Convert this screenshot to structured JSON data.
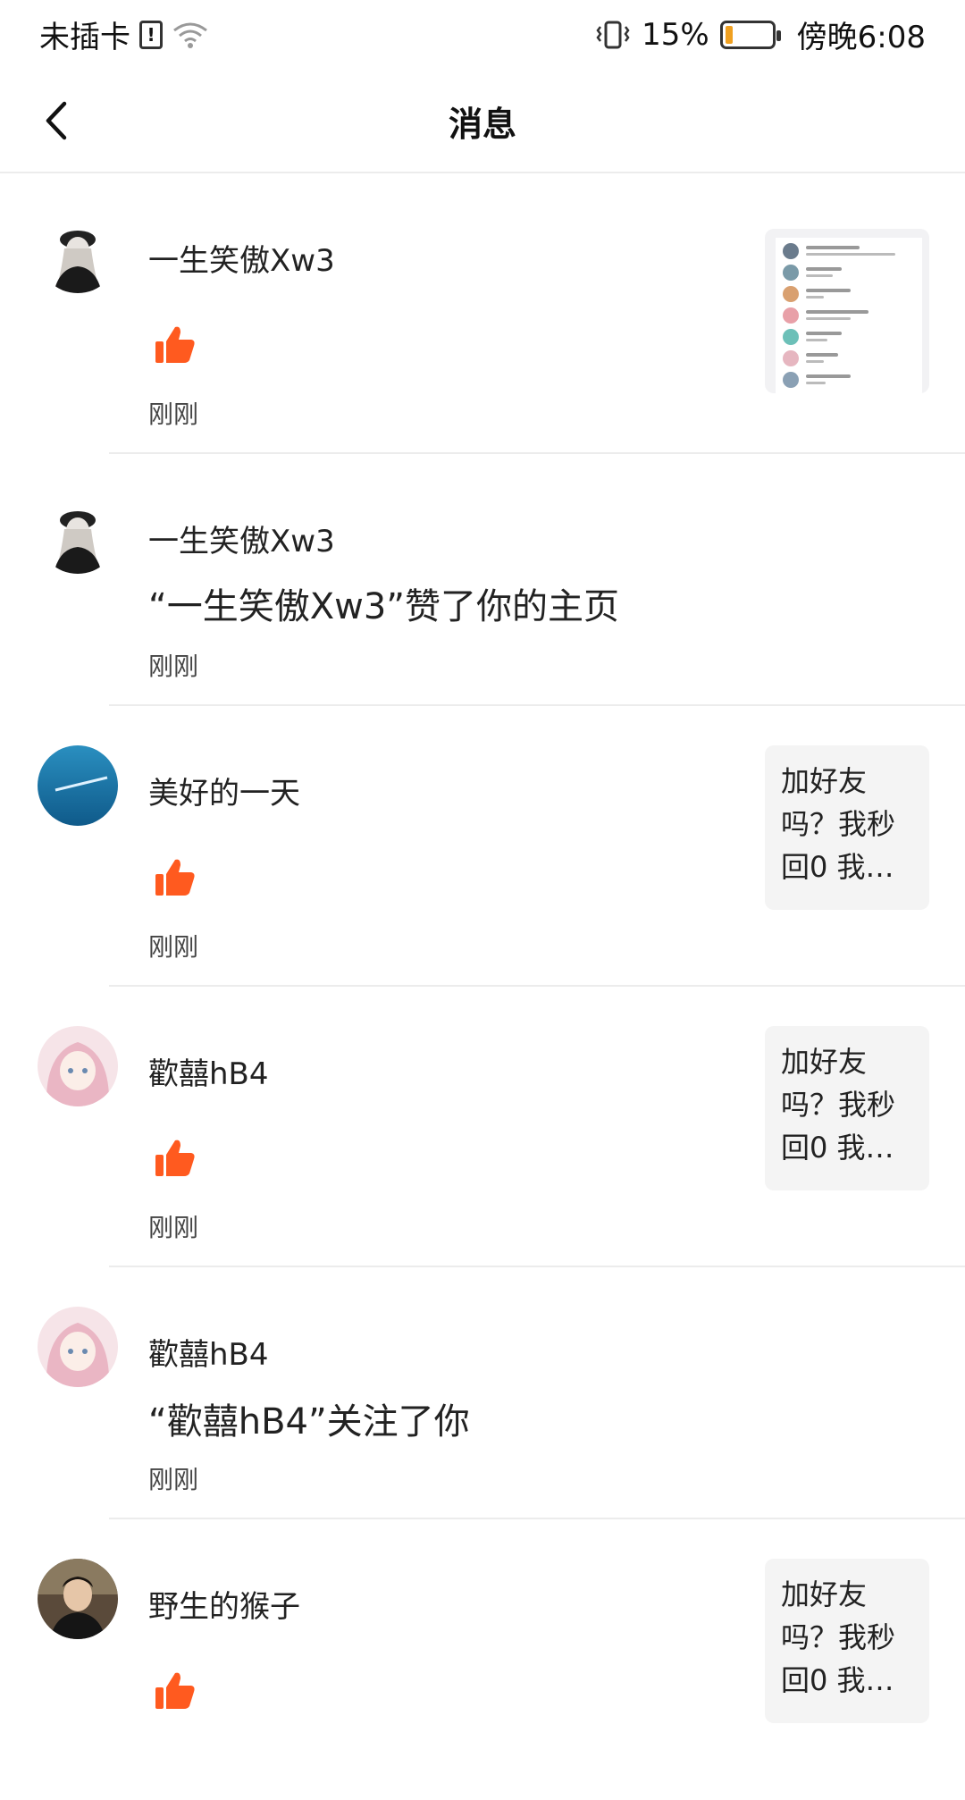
{
  "status_bar": {
    "carrier": "未插卡",
    "sim_icon": "sim-alert-icon",
    "wifi_icon": "wifi-icon",
    "vibrate_icon": "vibrate-icon",
    "battery_percent": "15%",
    "battery_level": 0.15,
    "time": "傍晚6:08"
  },
  "header": {
    "back_icon": "chevron-left-icon",
    "title": "消息"
  },
  "messages": [
    {
      "username": "一生笑傲Xw3",
      "action": "like",
      "text": "",
      "time": "刚刚",
      "preview_type": "screenshot",
      "preview_text": ""
    },
    {
      "username": "一生笑傲Xw3",
      "action": "text",
      "text": "“一生笑傲Xw3”赞了你的主页",
      "time": "刚刚",
      "preview_type": "none",
      "preview_text": ""
    },
    {
      "username": "美好的一天",
      "action": "like",
      "text": "",
      "time": "刚刚",
      "preview_type": "text",
      "preview_text": "加好友吗？我秒回0 我…"
    },
    {
      "username": "歡囍hB4",
      "action": "like",
      "text": "",
      "time": "刚刚",
      "preview_type": "text",
      "preview_text": "加好友吗？我秒回0 我…"
    },
    {
      "username": "歡囍hB4",
      "action": "text",
      "text": "“歡囍hB4”关注了你",
      "time": "刚刚",
      "preview_type": "none",
      "preview_text": ""
    },
    {
      "username": "野生的猴子",
      "action": "like",
      "text": "",
      "time": "",
      "preview_type": "text",
      "preview_text": "加好友吗？我秒回0 我…"
    }
  ],
  "colors": {
    "like": "#ff5a1f",
    "divider": "#ececec",
    "battery_fill": "#f0a020"
  }
}
